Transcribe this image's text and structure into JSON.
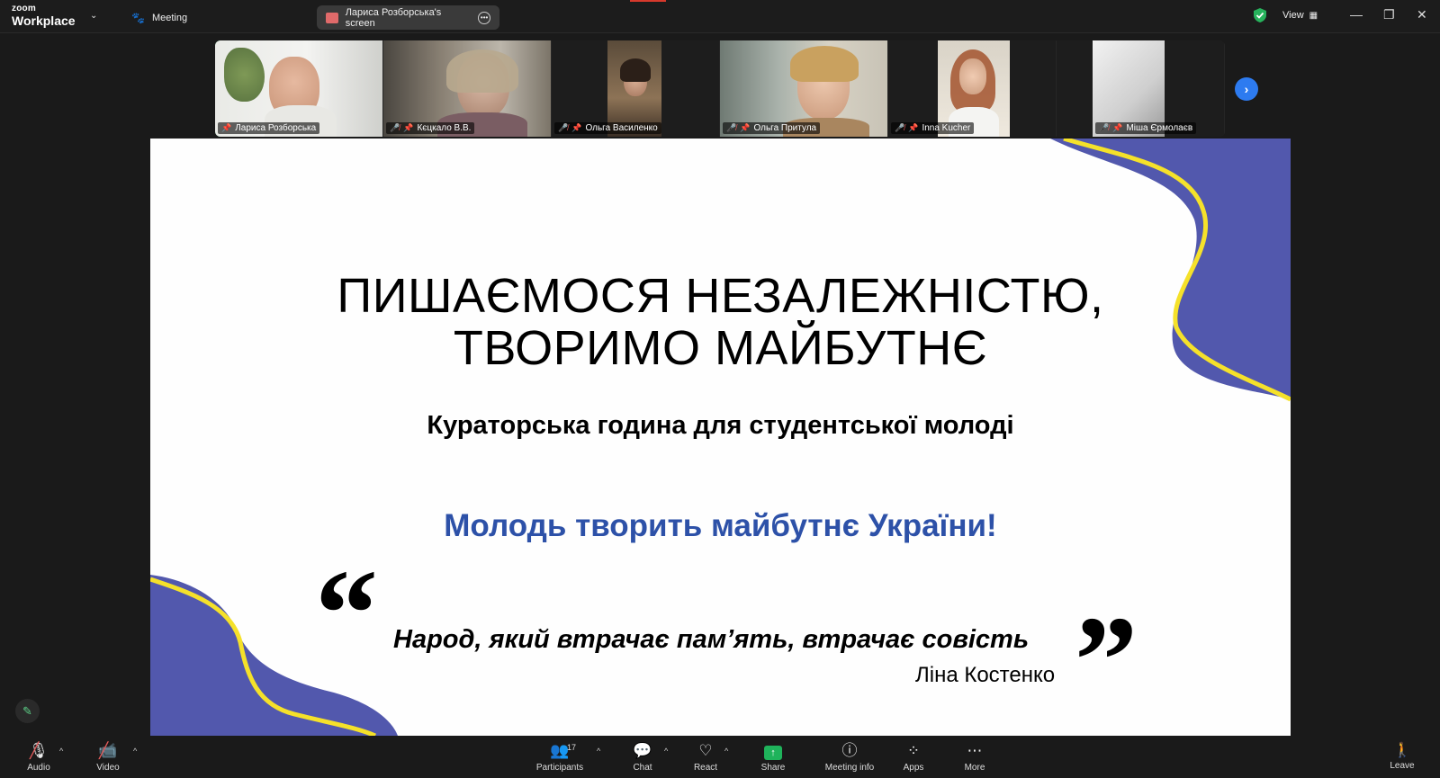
{
  "app": {
    "brand_top": "zoom",
    "brand_name": "Workplace"
  },
  "tabs": {
    "meeting": "Meeting",
    "screen": "Лариса Розборська's screen"
  },
  "top_right": {
    "view_label": "View"
  },
  "participants": [
    {
      "name": "Лариса Розборська",
      "muted": false,
      "active": true
    },
    {
      "name": "Кєцкало В.В.",
      "muted": true,
      "active": false
    },
    {
      "name": "Ольга Василенко",
      "muted": true,
      "active": false
    },
    {
      "name": "Ольга Притула",
      "muted": true,
      "active": false
    },
    {
      "name": "Inna Kucher",
      "muted": true,
      "active": false
    },
    {
      "name": "Міша Єрмолаєв",
      "muted": true,
      "active": false
    }
  ],
  "slide": {
    "title_line1": "ПИШАЄМОСЯ НЕЗАЛЕЖНІСТЮ,",
    "title_line2": "ТВОРИМО МАЙБУТНЄ",
    "subtitle": "Кураторська година для студентської молоді",
    "tagline": "Молодь творить майбутнє України!",
    "quote_open": "“",
    "quote_close": "”",
    "quote": "Народ, який втрачає пам’ять, втрачає совість",
    "author": "Ліна Костенко",
    "colors": {
      "blue": "#5258ad",
      "yellow": "#f5e12a",
      "tagline": "#2d51a8"
    }
  },
  "toolbar": {
    "audio": "Audio",
    "video": "Video",
    "participants": "Participants",
    "participants_count": "17",
    "chat": "Chat",
    "react": "React",
    "share": "Share",
    "meeting_info": "Meeting info",
    "apps": "Apps",
    "more": "More",
    "leave": "Leave"
  }
}
